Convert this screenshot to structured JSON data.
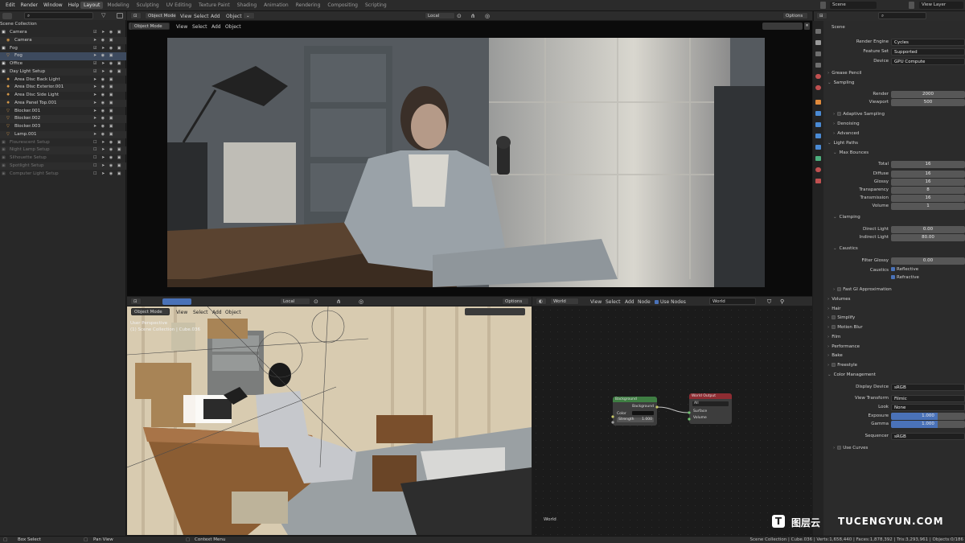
{
  "topbar": {
    "menu": [
      "Edit",
      "Render",
      "Window",
      "Help"
    ],
    "tabs": [
      "Layout",
      "Modeling",
      "Sculpting",
      "UV Editing",
      "Texture Paint",
      "Shading",
      "Animation",
      "Rendering",
      "Compositing",
      "Scripting"
    ],
    "active_tab": "Layout",
    "scene": "Scene",
    "view_layer": "View Layer"
  },
  "outliner": {
    "root": "Scene Collection",
    "rows": [
      {
        "name": "Camera",
        "level": 0,
        "type": "collection",
        "vis": true
      },
      {
        "name": "Camera",
        "level": 1,
        "type": "camera",
        "vis": true
      },
      {
        "name": "Fog",
        "level": 0,
        "type": "collection",
        "vis": true
      },
      {
        "name": "Fog",
        "level": 1,
        "type": "object",
        "vis": true,
        "selected": true
      },
      {
        "name": "Office",
        "level": 0,
        "type": "collection",
        "vis": true
      },
      {
        "name": "Day Light Setup",
        "level": 0,
        "type": "collection",
        "vis": true
      },
      {
        "name": "Area Disc Back Light",
        "level": 1,
        "type": "light",
        "vis": true
      },
      {
        "name": "Area Disc Exterior.001",
        "level": 1,
        "type": "light",
        "vis": true
      },
      {
        "name": "Area Disc Side Light",
        "level": 1,
        "type": "light",
        "vis": true
      },
      {
        "name": "Area Panel Top.001",
        "level": 1,
        "type": "light",
        "vis": true
      },
      {
        "name": "Blocker.001",
        "level": 1,
        "type": "mesh",
        "vis": true
      },
      {
        "name": "Blocker.002",
        "level": 1,
        "type": "mesh",
        "vis": true
      },
      {
        "name": "Blocker.003",
        "level": 1,
        "type": "mesh",
        "vis": true
      },
      {
        "name": "Lamp.001",
        "level": 1,
        "type": "mesh",
        "vis": true
      },
      {
        "name": "Flourescent Setup",
        "level": 0,
        "type": "collection",
        "vis": false
      },
      {
        "name": "Night Lamp Setup",
        "level": 0,
        "type": "collection",
        "vis": false
      },
      {
        "name": "Silhouette Setup",
        "level": 0,
        "type": "collection",
        "vis": false
      },
      {
        "name": "Spotlight Setup",
        "level": 0,
        "type": "collection",
        "vis": false
      },
      {
        "name": "Computer Light Setup",
        "level": 0,
        "type": "collection",
        "vis": false
      }
    ]
  },
  "viewport1": {
    "mode": "Object Mode",
    "menus": [
      "View",
      "Select",
      "Add",
      "Object"
    ],
    "transform": "Local",
    "options": "Options"
  },
  "viewport2": {
    "mode": "Object Mode",
    "menus": [
      "View",
      "Select",
      "Add",
      "Object"
    ],
    "transform": "Local",
    "options": "Options",
    "overlay_line1": "User Perspective",
    "overlay_line2": "(1) Scene Collection | Cube.036"
  },
  "node_editor": {
    "world_type": "World",
    "menus": [
      "View",
      "Select",
      "Add",
      "Node"
    ],
    "use_nodes": "Use Nodes",
    "world_name": "World",
    "footer": "World",
    "background_node": {
      "title": "Background",
      "output": "Background",
      "color_label": "Color",
      "strength_label": "Strength",
      "strength": "1.000"
    },
    "output_node": {
      "title": "World Output",
      "target": "All",
      "surface": "Surface",
      "volume": "Volume"
    }
  },
  "properties": {
    "scene": "Scene",
    "render_engine": {
      "label": "Render Engine",
      "value": "Cycles"
    },
    "feature_set": {
      "label": "Feature Set",
      "value": "Supported"
    },
    "device": {
      "label": "Device",
      "value": "GPU Compute"
    },
    "grease_pencil": "Grease Pencil",
    "sampling": {
      "title": "Sampling",
      "render_label": "Render",
      "render": "2000",
      "viewport_label": "Viewport",
      "viewport": "500",
      "adaptive": "Adaptive Sampling",
      "denoising": "Denoising",
      "advanced": "Advanced"
    },
    "light_paths": {
      "title": "Light Paths",
      "max_bounces": "Max Bounces",
      "total": {
        "label": "Total",
        "value": "16"
      },
      "diffuse": {
        "label": "Diffuse",
        "value": "16"
      },
      "glossy": {
        "label": "Glossy",
        "value": "16"
      },
      "transparency": {
        "label": "Transparency",
        "value": "8"
      },
      "transmission": {
        "label": "Transmission",
        "value": "16"
      },
      "volume": {
        "label": "Volume",
        "value": "1"
      },
      "clamping": "Clamping",
      "direct": {
        "label": "Direct Light",
        "value": "0.00"
      },
      "indirect": {
        "label": "Indirect Light",
        "value": "80.00"
      },
      "caustics": "Caustics",
      "filter_glossy": {
        "label": "Filter Glossy",
        "value": "0.00"
      },
      "caustics_label": "Caustics",
      "reflective": "Reflective",
      "refractive": "Refractive",
      "fast_gi": "Fast GI Approximation"
    },
    "volumes": "Volumes",
    "hair": "Hair",
    "simplify": "Simplify",
    "motion_blur": "Motion Blur",
    "film": "Film",
    "performance": "Performance",
    "bake": "Bake",
    "freestyle": "Freestyle",
    "color_management": {
      "title": "Color Management",
      "display_device": {
        "label": "Display Device",
        "value": "sRGB"
      },
      "view_transform": {
        "label": "View Transform",
        "value": "Filmic"
      },
      "look": {
        "label": "Look",
        "value": "None"
      },
      "exposure": {
        "label": "Exposure",
        "value": "1.000"
      },
      "gamma": {
        "label": "Gamma",
        "value": "1.000"
      },
      "sequencer": {
        "label": "Sequencer",
        "value": "sRGB"
      },
      "use_curves": "Use Curves"
    }
  },
  "status": {
    "box_select": "Box Select",
    "pan_view": "Pan View",
    "context_menu": "Context Menu",
    "stats": "Scene Collection | Cube.036 | Verts:1,658,440 | Faces:1,878,392 | Tris:3,293,961 | Objects:0/186"
  },
  "watermark": {
    "brand": "图层云",
    "site": "TUCENGYUN.COM"
  }
}
